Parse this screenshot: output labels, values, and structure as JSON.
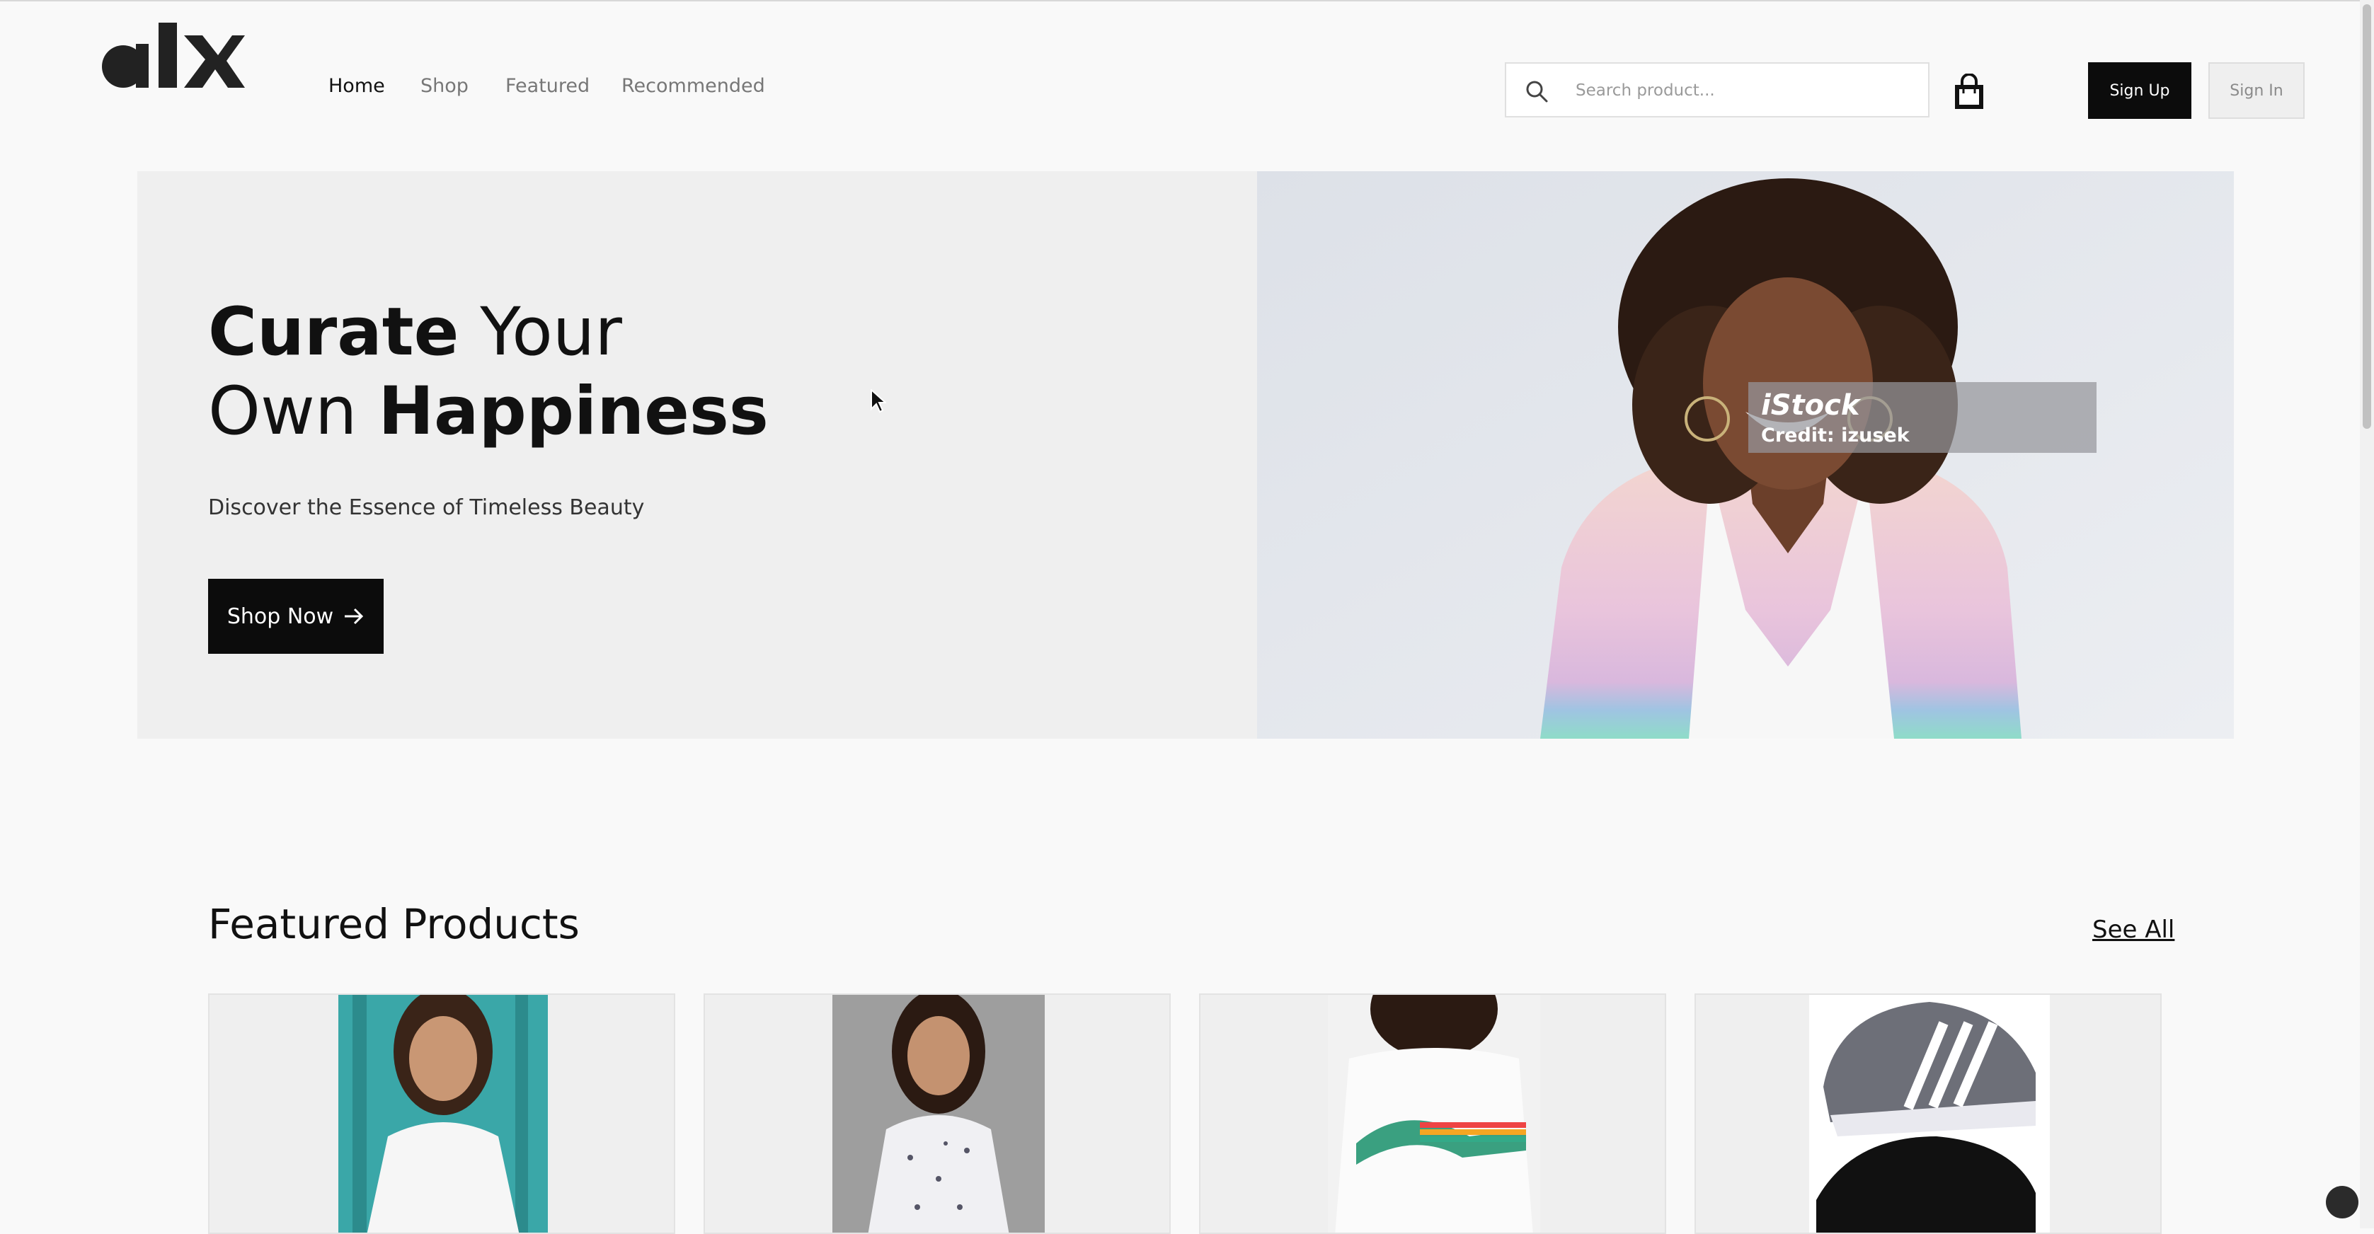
{
  "header": {
    "logo_text": "alx",
    "nav": [
      "Home",
      "Shop",
      "Featured",
      "Recommended"
    ],
    "search_placeholder": "Search product...",
    "signup_label": "Sign Up",
    "signin_label": "Sign In"
  },
  "hero": {
    "title_line1_bold": "Curate",
    "title_line1_rest": "Your",
    "title_line2_pre": "Own",
    "title_line2_bold": "Happiness",
    "subtitle": "Discover the Essence of Timeless Beauty",
    "cta_label": "Shop Now",
    "credit_brand": "iStock",
    "credit_text": "Credit: izusek"
  },
  "featured": {
    "title": "Featured Products",
    "see_all": "See All"
  },
  "colors": {
    "page_bg": "#f9f9f9",
    "accent_dark": "#0c0c0c",
    "hero_bg": "#efefef"
  },
  "icons": [
    "search-icon",
    "shopping-bag-icon",
    "arrow-right-icon",
    "mouse-cursor-icon",
    "floating-action-icon"
  ]
}
